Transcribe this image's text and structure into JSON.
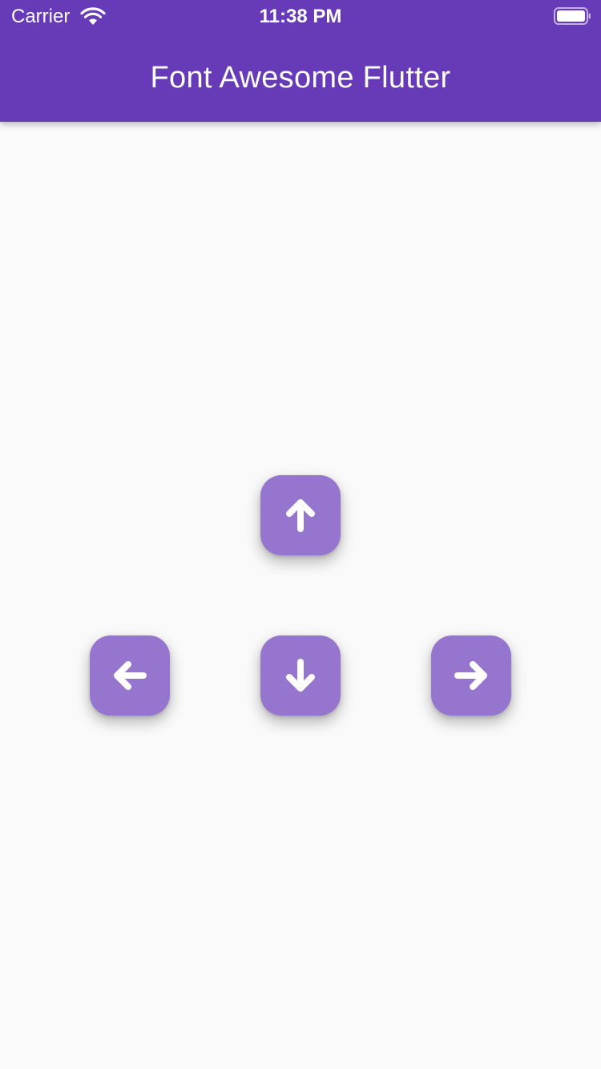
{
  "status_bar": {
    "carrier": "Carrier",
    "time": "11:38 PM",
    "wifi_icon": "wifi-icon",
    "battery_icon": "battery-icon"
  },
  "app_bar": {
    "title": "Font Awesome Flutter",
    "background_color": "#673ab7"
  },
  "controls": {
    "button_color": "#9575cd",
    "icon_color": "#ffffff",
    "buttons": [
      {
        "name": "up",
        "icon": "arrow-up-icon"
      },
      {
        "name": "left",
        "icon": "arrow-left-icon"
      },
      {
        "name": "down",
        "icon": "arrow-down-icon"
      },
      {
        "name": "right",
        "icon": "arrow-right-icon"
      }
    ]
  }
}
